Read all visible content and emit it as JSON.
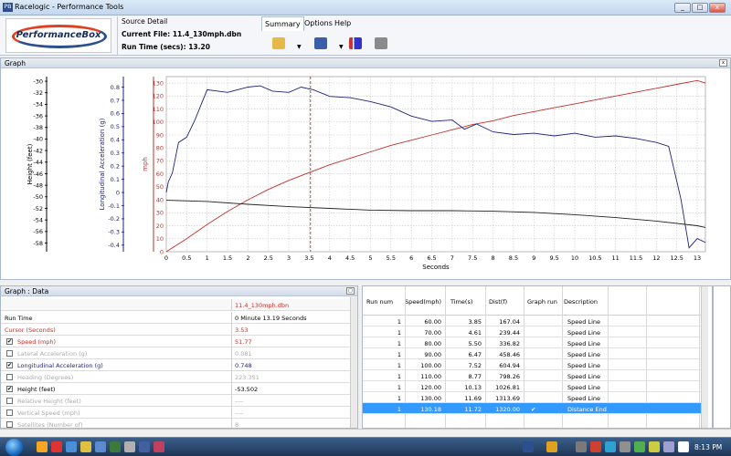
{
  "window": {
    "title": "Racelogic - Performance Tools",
    "min": "_",
    "max": "□",
    "close": "x",
    "app_icon_text": "PB"
  },
  "logo_text": "PerformanceBox",
  "source": {
    "heading": "Source Detail",
    "file_label": "Current File:",
    "file_value": "11.4_130mph.dbn",
    "runtime_label": "Run Time (secs):",
    "runtime_value": "13.20"
  },
  "menu": {
    "items": [
      "Summary",
      "Options",
      "Help"
    ]
  },
  "graph_panel": {
    "title": "Graph",
    "pin": "x"
  },
  "chart_data": {
    "type": "line",
    "xlabel": "Seconds",
    "xlim": [
      0,
      13.2
    ],
    "x_ticks": [
      "0",
      "0.5",
      "1",
      "1.5",
      "2",
      "2.5",
      "3",
      "3.5",
      "4",
      "4.5",
      "5",
      "5.5",
      "6",
      "6.5",
      "7",
      "7.5",
      "8",
      "8.5",
      "9",
      "9.5",
      "10",
      "10.5",
      "11",
      "11.5",
      "12",
      "12.5",
      "13"
    ],
    "cursor_x": 3.53,
    "axes": [
      {
        "label": "Height (feet)",
        "ticks": [
          "-30",
          "-32",
          "-34",
          "-36",
          "-38",
          "-40",
          "-42",
          "-44",
          "-46",
          "-48",
          "-50",
          "-52",
          "-54",
          "-56",
          "-58"
        ]
      },
      {
        "label": "Longitudinal Acceleration (g)",
        "ticks": [
          "0.8",
          "0.7",
          "0.6",
          "0.5",
          "0.4",
          "0.3",
          "0.2",
          "0.1",
          "0",
          "-0.1",
          "-0.2",
          "-0.3",
          "-0.4"
        ]
      },
      {
        "label": "mph",
        "ticks": [
          "130",
          "120",
          "110",
          "100",
          "90",
          "80",
          "70",
          "60",
          "50",
          "40",
          "30",
          "20",
          "10",
          "0"
        ],
        "ylim": [
          0,
          135
        ]
      }
    ],
    "series": [
      {
        "name": "Speed (mph)",
        "color": "#c0302a",
        "x": [
          0,
          0.5,
          1,
          1.5,
          2,
          2.5,
          3,
          3.5,
          4,
          4.5,
          5,
          5.5,
          6,
          6.5,
          7,
          7.5,
          8,
          8.5,
          9,
          9.5,
          10,
          10.5,
          11,
          11.5,
          12,
          12.5,
          13,
          13.2
        ],
        "y": [
          0,
          10,
          21,
          31,
          40,
          48,
          55,
          61,
          67,
          72,
          77,
          82,
          86,
          90,
          94,
          98,
          101,
          105,
          108,
          111,
          114,
          117,
          120,
          123,
          126,
          129,
          132,
          130
        ]
      },
      {
        "name": "Longitudinal Acceleration (g)",
        "color": "#22227a",
        "x": [
          0,
          0.05,
          0.15,
          0.3,
          0.5,
          0.7,
          1,
          1.5,
          2,
          2.3,
          2.6,
          3,
          3.3,
          3.6,
          4,
          4.5,
          5,
          5.5,
          6,
          6.5,
          7,
          7.3,
          7.6,
          8,
          8.5,
          9,
          9.5,
          10,
          10.5,
          11,
          11.5,
          12,
          12.3,
          12.6,
          12.8,
          13,
          13.2
        ],
        "y": [
          0.0,
          0.08,
          0.15,
          0.38,
          0.42,
          0.55,
          0.78,
          0.76,
          0.8,
          0.81,
          0.77,
          0.76,
          0.8,
          0.78,
          0.73,
          0.72,
          0.69,
          0.65,
          0.58,
          0.54,
          0.55,
          0.48,
          0.52,
          0.46,
          0.44,
          0.45,
          0.43,
          0.45,
          0.42,
          0.43,
          0.41,
          0.38,
          0.35,
          -0.05,
          -0.42,
          -0.35,
          -0.38
        ]
      },
      {
        "name": "Height (feet)",
        "color": "#222222",
        "x": [
          0,
          1,
          2,
          3,
          4,
          5,
          6,
          7,
          8,
          9,
          10,
          11,
          12,
          13,
          13.2
        ],
        "y": [
          -50.6,
          -50.8,
          -51.3,
          -51.7,
          -52.0,
          -52.3,
          -52.4,
          -52.4,
          -52.5,
          -52.7,
          -53.1,
          -53.6,
          -54.2,
          -55.0,
          -55.3
        ]
      }
    ]
  },
  "data_panel": {
    "title": "Graph : Data",
    "file_header": "11.4_130mph.dbn",
    "rows": [
      {
        "label": "Run Time",
        "value": "0 Minute 13.19 Seconds",
        "check": "",
        "color": "#000000"
      },
      {
        "label": "Cursor (Seconds)",
        "value": "3.53",
        "check": "",
        "color": "#c0302a"
      },
      {
        "label": "Speed (mph)",
        "value": "51.77",
        "check": "✔",
        "color": "#c0302a"
      },
      {
        "label": "Lateral Acceleration (g)",
        "value": "0.081",
        "check": "",
        "color": "#aaaaaa"
      },
      {
        "label": "Longitudinal Acceleration (g)",
        "value": "0.748",
        "check": "✔",
        "color": "#22227a"
      },
      {
        "label": "Heading (Degrees)",
        "value": "223.351",
        "check": "",
        "color": "#aaaaaa"
      },
      {
        "label": "Height (feet)",
        "value": "-53.502",
        "check": "✔",
        "color": "#000000"
      },
      {
        "label": "Relative Height (feet)",
        "value": "----",
        "check": "",
        "color": "#aaaaaa"
      },
      {
        "label": "Vertical Speed (mph)",
        "value": "----",
        "check": "",
        "color": "#aaaaaa"
      },
      {
        "label": "Satellites (Number of)",
        "value": "8",
        "check": "",
        "color": "#aaaaaa"
      }
    ]
  },
  "run_panel": {
    "headers": [
      "Run num",
      "Speed(mph)",
      "Time(s)",
      "Dist(f)",
      "Graph run",
      "Description"
    ],
    "rows": [
      [
        "1",
        "60.00",
        "3.85",
        "167.04",
        "",
        "Speed Line"
      ],
      [
        "1",
        "70.00",
        "4.61",
        "239.44",
        "",
        "Speed Line"
      ],
      [
        "1",
        "80.00",
        "5.50",
        "336.82",
        "",
        "Speed Line"
      ],
      [
        "1",
        "90.00",
        "6.47",
        "458.46",
        "",
        "Speed Line"
      ],
      [
        "1",
        "100.00",
        "7.52",
        "604.94",
        "",
        "Speed Line"
      ],
      [
        "1",
        "110.00",
        "8.77",
        "798.26",
        "",
        "Speed Line"
      ],
      [
        "1",
        "120.00",
        "10.13",
        "1026.81",
        "",
        "Speed Line"
      ],
      [
        "1",
        "130.00",
        "11.69",
        "1313.69",
        "",
        "Speed Line"
      ],
      [
        "1",
        "130.18",
        "11.72",
        "1320.00",
        "✔",
        "Distance End"
      ]
    ]
  },
  "taskbar": {
    "clock": "8:13 PM"
  }
}
